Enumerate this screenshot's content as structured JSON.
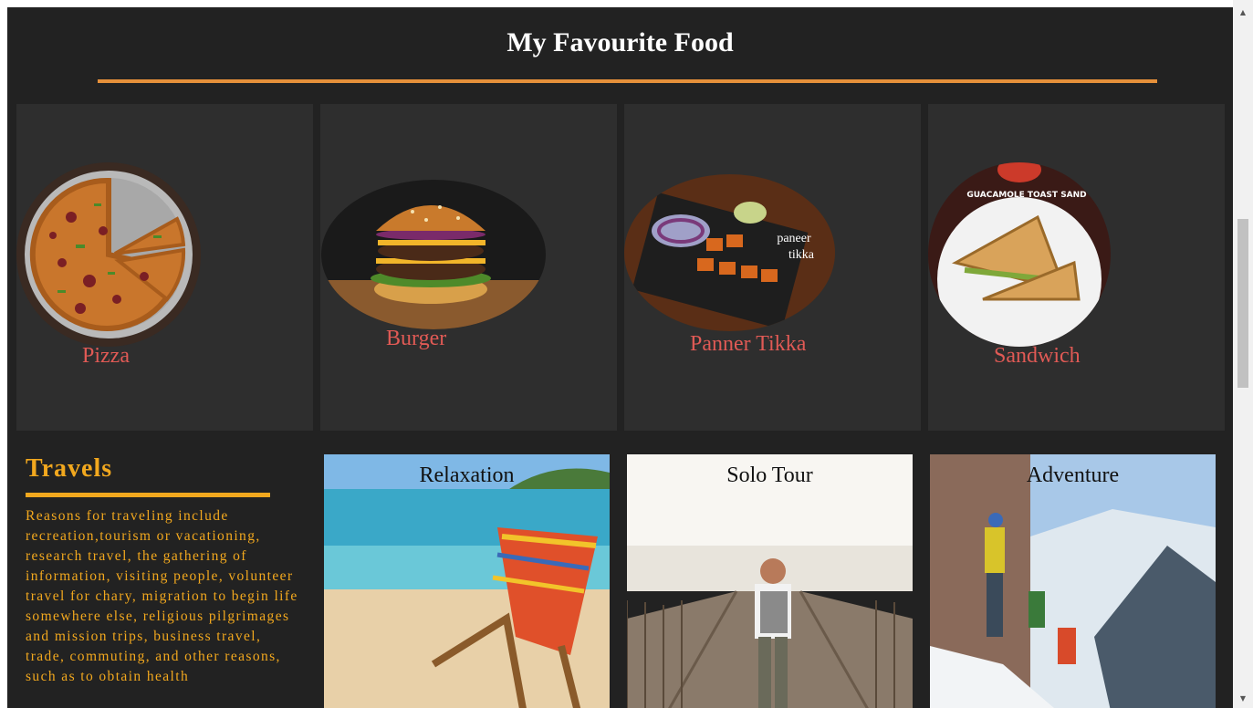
{
  "header": {
    "title": "My Favourite Food"
  },
  "foods": [
    {
      "label": "Pizza"
    },
    {
      "label": "Burger"
    },
    {
      "label": "Panner Tikka",
      "overlay_text_1": "paneer",
      "overlay_text_2": "tikka"
    },
    {
      "label": "Sandwich",
      "overlay_text": "GUACAMOLE TOAST SAND"
    }
  ],
  "travels": {
    "title": "Travels",
    "body": "Reasons for traveling include recreation,tourism or vacationing, research travel, the gathering of information, visiting people, volunteer travel for chary, migration to begin life somewhere else, religious pilgrimages and mission trips, business travel, trade, commuting, and other reasons, such as to obtain health"
  },
  "travel_cards": [
    {
      "label": "Relaxation"
    },
    {
      "label": "Solo Tour"
    },
    {
      "label": "Adventure"
    }
  ],
  "colors": {
    "page_bg": "#222222",
    "card_bg": "#2e2e2e",
    "accent_rule": "#e6903a",
    "travel_accent": "#f2a81e",
    "food_label": "#e05a55"
  },
  "scrollbar": {
    "up_icon": "arrow-up-icon",
    "down_icon": "arrow-down-icon"
  }
}
